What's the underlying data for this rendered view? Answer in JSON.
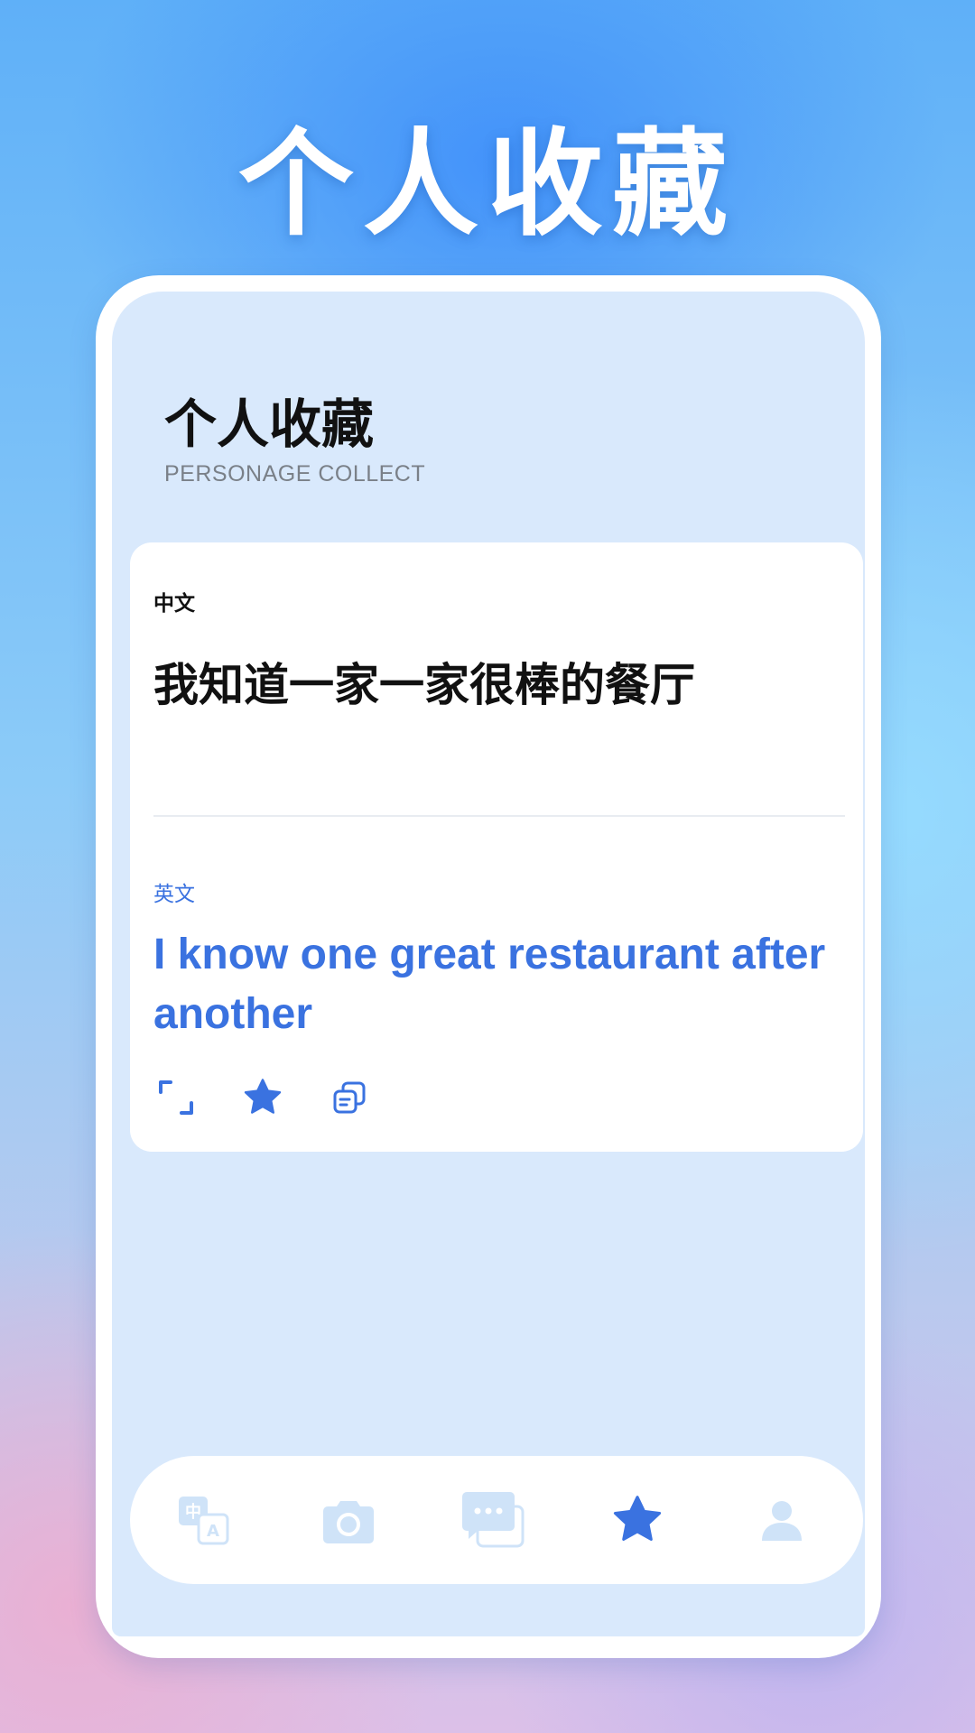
{
  "banner": {
    "title": "个人收藏"
  },
  "header": {
    "title": "个人收藏",
    "subtitle": "PERSONAGE COLLECT"
  },
  "card": {
    "source_lang": "中文",
    "source_text": "我知道一家一家很棒的餐厅",
    "target_lang": "英文",
    "target_text": "I know one great restaurant after another"
  },
  "actions": [
    "expand-icon",
    "star-icon",
    "copy-icon"
  ],
  "tabbar": {
    "items": [
      "translate-icon",
      "camera-icon",
      "chat-icon",
      "star-icon",
      "user-icon"
    ],
    "active_index": 3
  },
  "colors": {
    "accent": "#3a72e0",
    "inactive": "#cfe3f8",
    "screen_bg": "#d9e9fc"
  }
}
